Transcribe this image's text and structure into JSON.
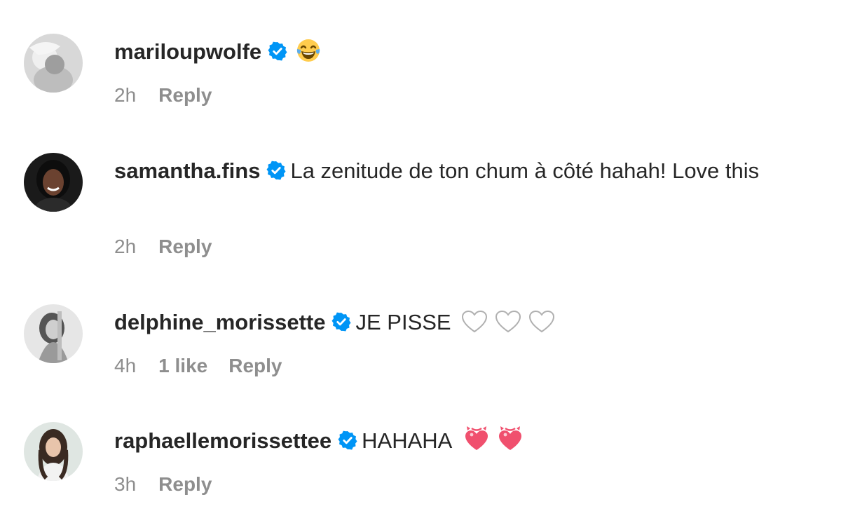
{
  "comments": [
    {
      "username": "mariloupwolfe",
      "text": "",
      "emoji": "tears-of-joy-emoji",
      "time": "2h",
      "likes": "",
      "reply": "Reply"
    },
    {
      "username": "samantha.fins",
      "text": "La zenitude de ton chum à côté hahah! Love this",
      "time": "2h",
      "likes": "",
      "reply": "Reply"
    },
    {
      "username": "delphine_morissette",
      "text": "JE PISSE",
      "emoji": "white-heart-emoji",
      "time": "4h",
      "likes": "1 like",
      "reply": "Reply"
    },
    {
      "username": "raphaellemorissettee",
      "text": "HAHAHA",
      "emoji": "heart-with-ribbon-emoji",
      "time": "3h",
      "likes": "",
      "reply": "Reply"
    }
  ],
  "colors": {
    "verified": "#0095f6",
    "meta_text": "#8e8e8e",
    "primary_text": "#262626",
    "heart_pink": "#f0506e"
  }
}
